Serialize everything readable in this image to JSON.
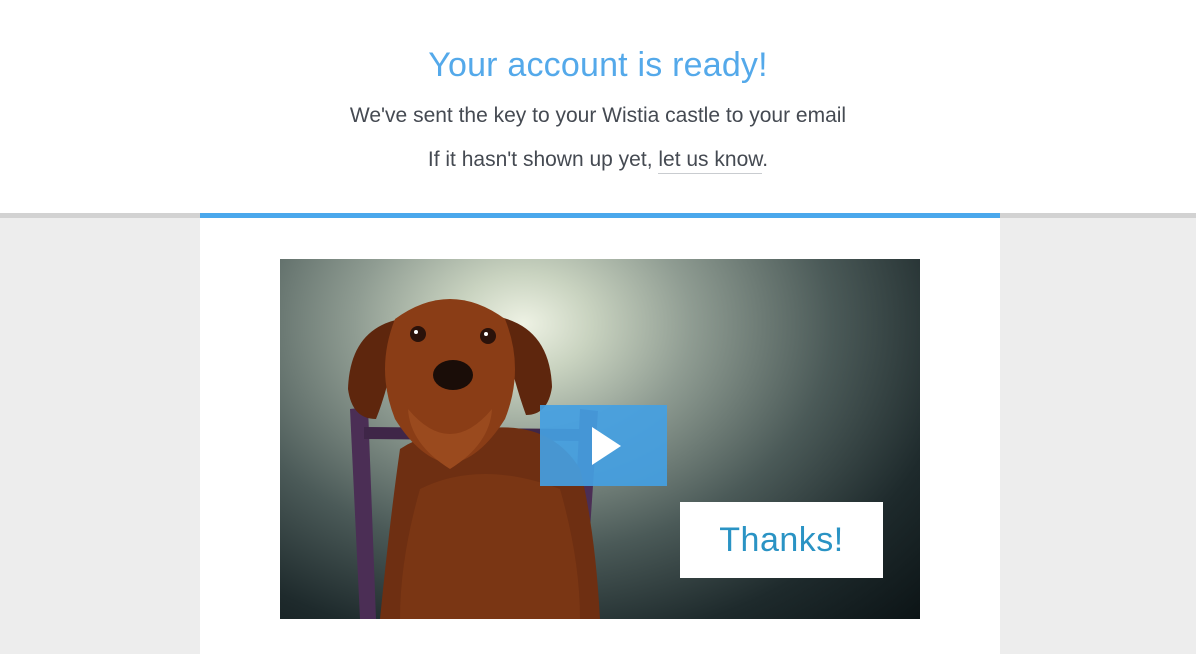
{
  "header": {
    "title": "Your account is ready!",
    "line1": "We've sent the key to your Wistia castle to your email",
    "line2_prefix": "If it hasn't shown up yet, ",
    "line2_link": "let us know",
    "line2_suffix": "."
  },
  "video": {
    "overlay_text": "Thanks!",
    "play_icon": "play-icon"
  },
  "colors": {
    "accent": "#4aa8ec",
    "title": "#54a9ea",
    "thanks_text": "#2a93c4",
    "page_bg_bottom": "#ededed"
  }
}
